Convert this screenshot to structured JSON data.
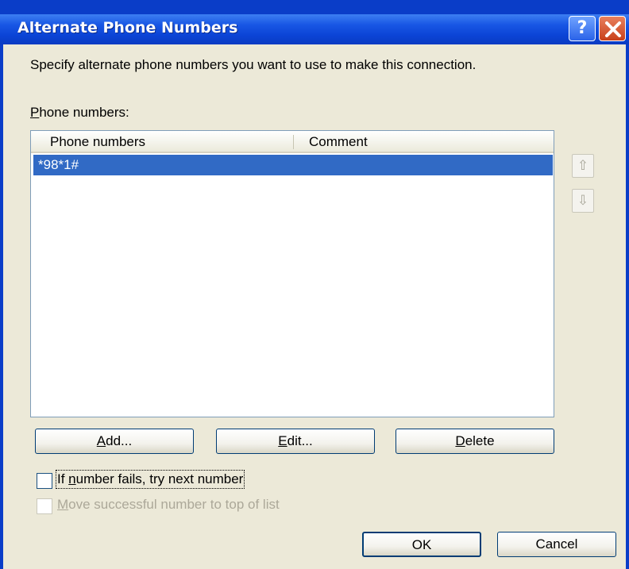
{
  "window": {
    "title": "Alternate Phone Numbers",
    "help_glyph": "?",
    "close_glyph": "X"
  },
  "instructions": "Specify alternate phone numbers you want to use to make this connection.",
  "phone_label": {
    "mnemonic": "P",
    "rest": "hone numbers:"
  },
  "list": {
    "columns": [
      "Phone numbers",
      "Comment"
    ],
    "rows": [
      {
        "phone": "*98*1#",
        "comment": "",
        "selected": true
      }
    ]
  },
  "arrows": {
    "up_icon": "arrow-up-icon",
    "down_icon": "arrow-down-icon",
    "up_glyph": "⇧",
    "down_glyph": "⇩"
  },
  "buttons": {
    "add": {
      "mnemonic": "A",
      "rest": "dd..."
    },
    "edit": {
      "mnemonic": "E",
      "rest": "dit..."
    },
    "delete": {
      "mnemonic": "D",
      "rest": "elete"
    },
    "ok": "OK",
    "cancel": "Cancel"
  },
  "options": {
    "try_next": {
      "prefix": "If ",
      "mnemonic": "n",
      "rest": "umber fails, try next number",
      "checked": false
    },
    "move_top": {
      "mnemonic": "M",
      "rest": "ove successful number to top of list",
      "checked": false,
      "disabled": true
    }
  },
  "colors": {
    "titlebar": "#0b44d6",
    "selection": "#316ac5",
    "dialog_bg": "#ece9d8"
  }
}
